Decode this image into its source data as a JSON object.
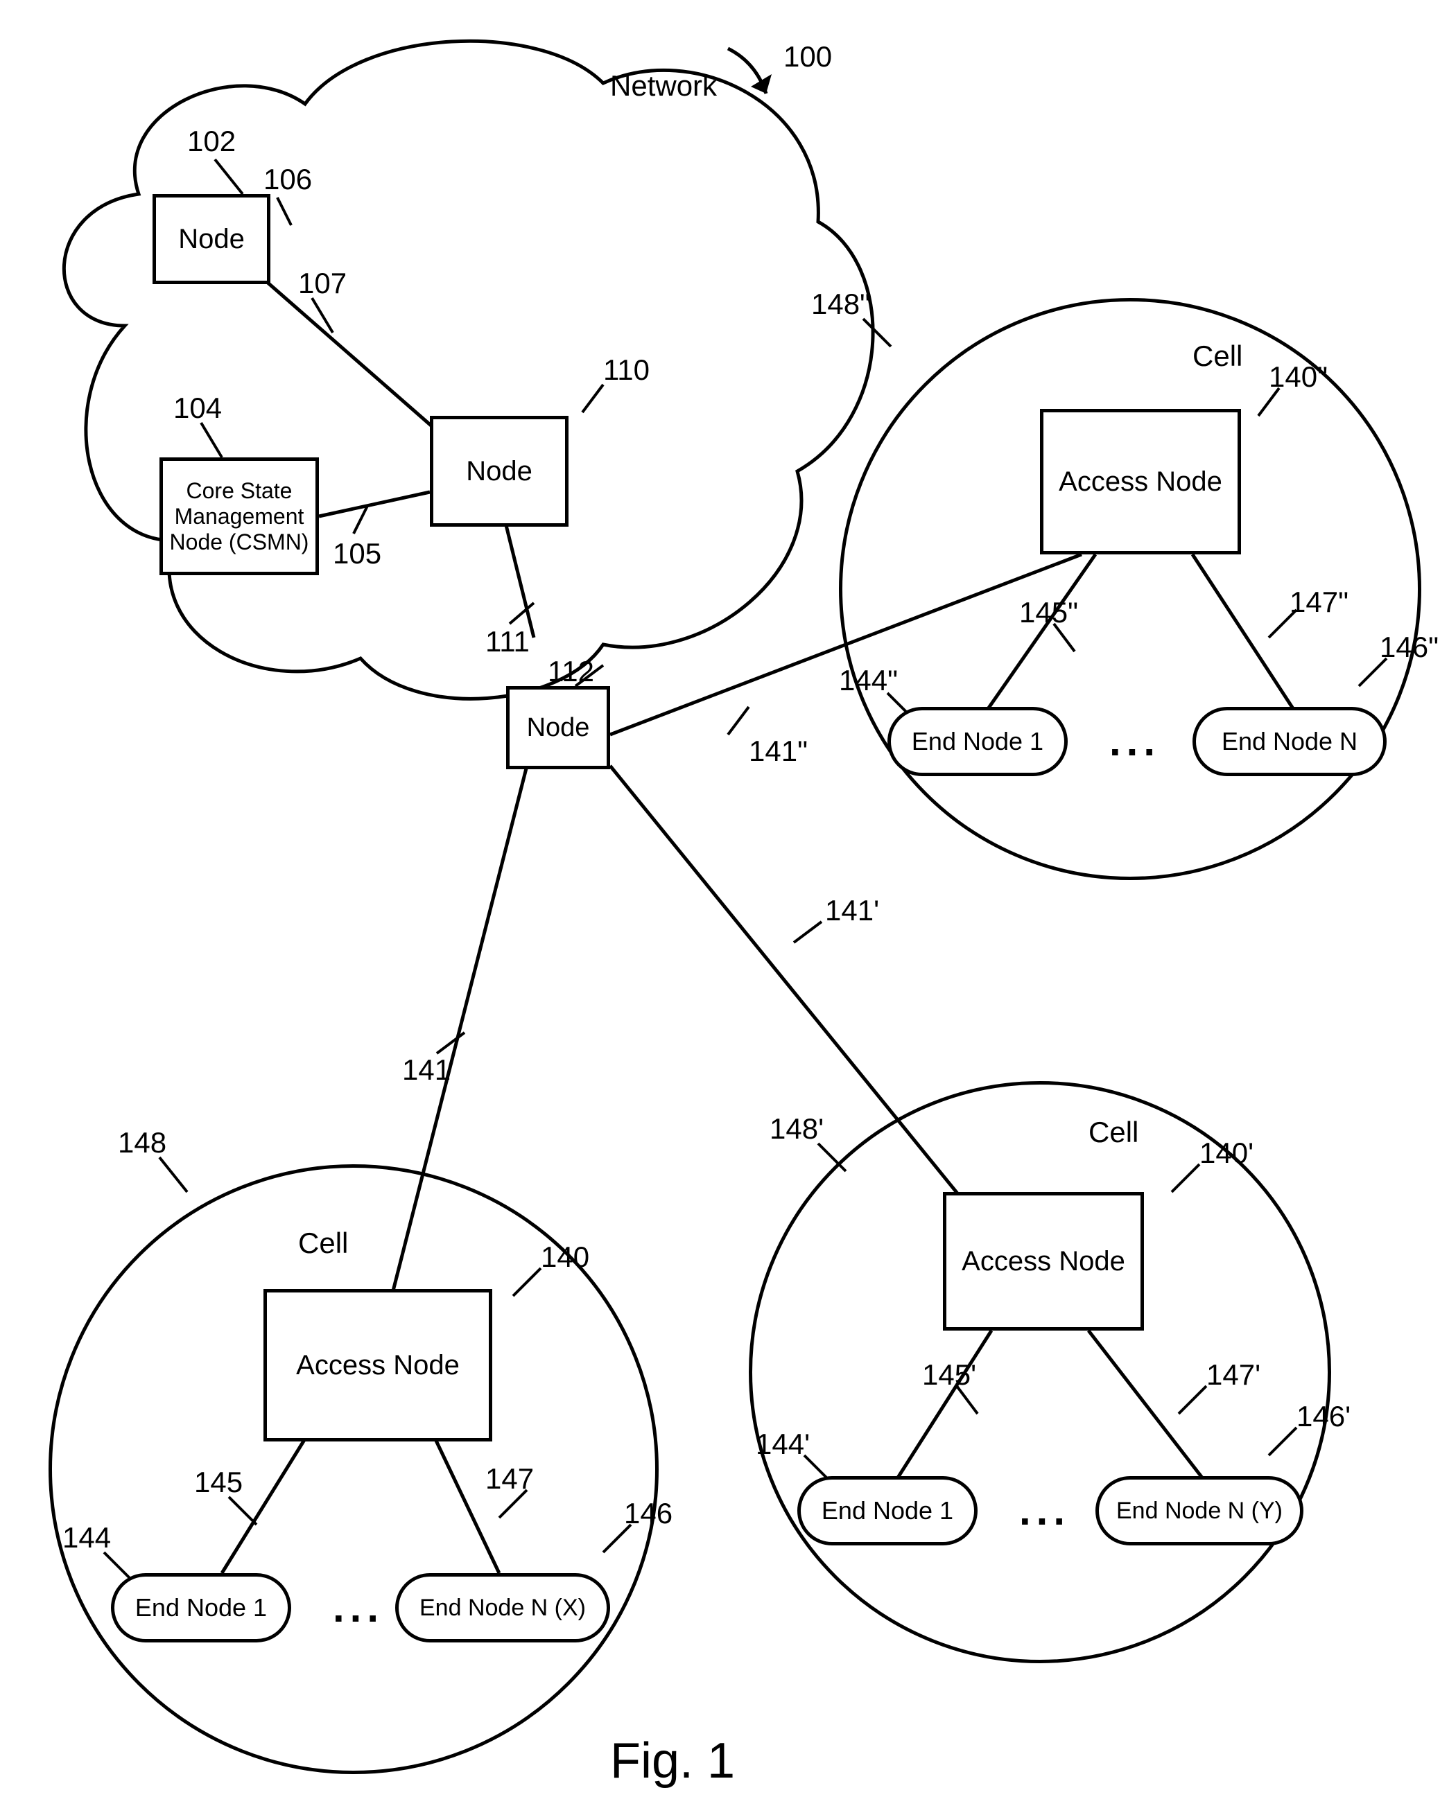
{
  "figure_caption": "Fig. 1",
  "network_label": "Network",
  "cell_label": "Cell",
  "nodes": {
    "node106": "Node",
    "node110": "Node",
    "node112": "Node",
    "csmn": "Core State\nManagement\nNode (CSMN)"
  },
  "cells": {
    "c148": {
      "access": "Access Node",
      "end1": "End Node 1",
      "endn": "End Node N (X)"
    },
    "c148p": {
      "access": "Access Node",
      "end1": "End Node 1",
      "endn": "End Node N (Y)"
    },
    "c148pp": {
      "access": "Access Node",
      "end1": "End Node 1",
      "endn": "End Node N"
    }
  },
  "ellipsis": "...",
  "refs": {
    "r100": "100",
    "r102": "102",
    "r104": "104",
    "r105": "105",
    "r106": "106",
    "r107": "107",
    "r110": "110",
    "r111": "111",
    "r112": "112",
    "r140": "140",
    "r140p": "140'",
    "r140pp": "140\"",
    "r141": "141",
    "r141p": "141'",
    "r141pp": "141\"",
    "r144": "144",
    "r144p": "144'",
    "r144pp": "144\"",
    "r145": "145",
    "r145p": "145'",
    "r145pp": "145\"",
    "r146": "146",
    "r146p": "146'",
    "r146pp": "146\"",
    "r147": "147",
    "r147p": "147'",
    "r147pp": "147\"",
    "r148": "148",
    "r148p": "148'",
    "r148pp": "148\""
  }
}
